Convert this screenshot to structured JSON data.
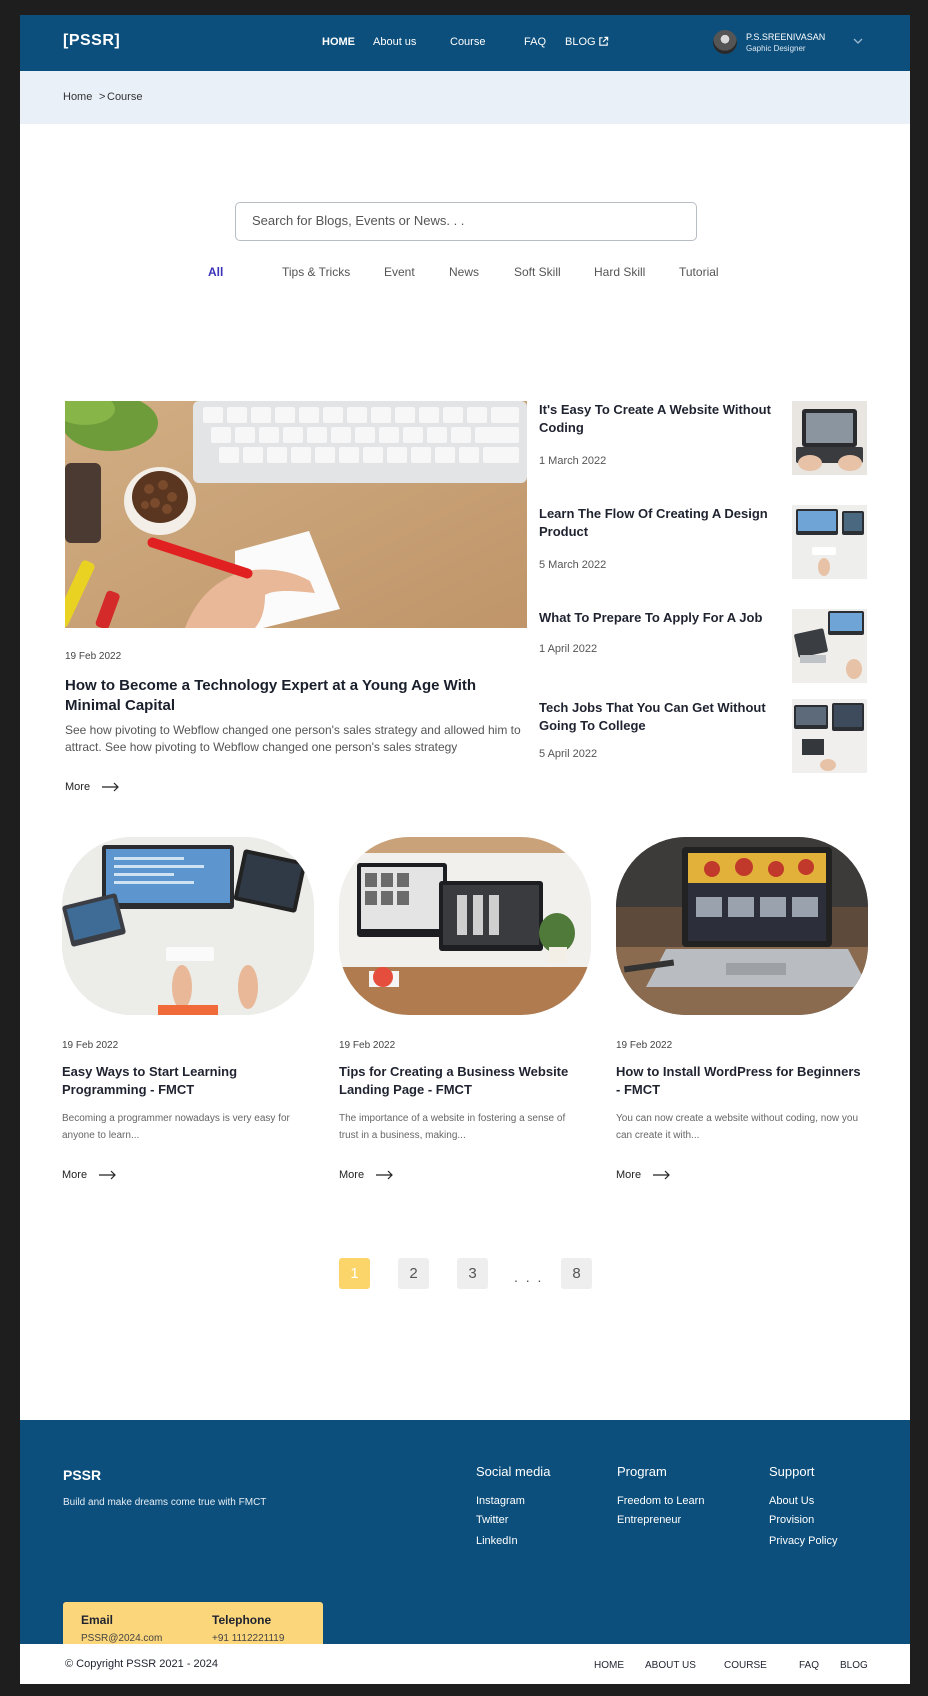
{
  "header": {
    "logo": "[PSSR]",
    "nav": [
      {
        "label": "HOME"
      },
      {
        "label": "About us"
      },
      {
        "label": "Course"
      },
      {
        "label": "FAQ"
      },
      {
        "label": "BLOG"
      }
    ],
    "user": {
      "name": "P.S.SREENIVASAN",
      "role": "Gaphic Designer"
    }
  },
  "breadcrumb": {
    "home": "Home",
    "separator": ">",
    "current": "Course"
  },
  "search": {
    "placeholder": "Search for Blogs, Events or News. . ."
  },
  "filters": [
    {
      "label": "All",
      "active": true
    },
    {
      "label": "Tips & Tricks"
    },
    {
      "label": "Event"
    },
    {
      "label": "News"
    },
    {
      "label": "Soft Skill"
    },
    {
      "label": "Hard Skill"
    },
    {
      "label": "Tutorial"
    }
  ],
  "featured": {
    "date": "19 Feb 2022",
    "title": "How to Become a Technology Expert at a Young Age With Minimal Capital",
    "excerpt": "See how pivoting to Webflow changed one person's sales strategy and allowed him to attract. See how pivoting to Webflow changed one person's sales strategy",
    "more": "More"
  },
  "side_posts": [
    {
      "title": "It's Easy To Create A Website Without Coding",
      "date": "1 March  2022"
    },
    {
      "title": "Learn The Flow Of Creating A Design Product",
      "date": "5 March  2022"
    },
    {
      "title": "What To Prepare To Apply For A Job",
      "date": "1 April  2022"
    },
    {
      "title": "Tech Jobs That You Can Get Without Going To College",
      "date": "5 April 2022"
    }
  ],
  "cards": [
    {
      "date": "19 Feb 2022",
      "title": "Easy Ways to Start Learning Programming - FMCT",
      "excerpt": "Becoming a programmer nowadays is very easy for anyone to learn...",
      "more": "More"
    },
    {
      "date": "19 Feb 2022",
      "title": "Tips for Creating a Business Website Landing Page - FMCT",
      "excerpt": "The importance of a website in fostering a sense of trust in a business, making...",
      "more": "More"
    },
    {
      "date": "19 Feb 2022",
      "title": "How to Install WordPress for Beginners - FMCT",
      "excerpt": "You can now create a website without coding, now you can create it with...",
      "more": "More"
    }
  ],
  "pagination": {
    "pages": [
      "1",
      "2",
      "3",
      "8"
    ],
    "ellipsis": ". . .",
    "current": "1"
  },
  "footer": {
    "brand": "PSSR",
    "tagline": "Build and make dreams come true with FMCT",
    "social": {
      "heading": "Social media",
      "links": [
        "Instagram",
        "Twitter",
        "LinkedIn"
      ]
    },
    "program": {
      "heading": "Program",
      "links": [
        "Freedom to Learn",
        "Entrepreneur"
      ]
    },
    "support": {
      "heading": "Support",
      "links": [
        "About Us",
        "Provision",
        "Privacy Policy"
      ]
    },
    "contact": {
      "email_label": "Email",
      "email": "PSSR@2024.com",
      "phone_label": "Telephone",
      "phone": "+91 1112221119"
    }
  },
  "bottom_bar": {
    "copyright": "© Copyright PSSR 2021 - 2024",
    "links": [
      "HOME",
      "ABOUT US",
      "COURSE",
      "FAQ",
      "BLOG"
    ]
  },
  "colors": {
    "primary": "#0c4f7c",
    "accent_yellow": "#fbd46a",
    "active_tab": "#3a33b8",
    "breadcrumb_bg": "#eaf0f8"
  }
}
